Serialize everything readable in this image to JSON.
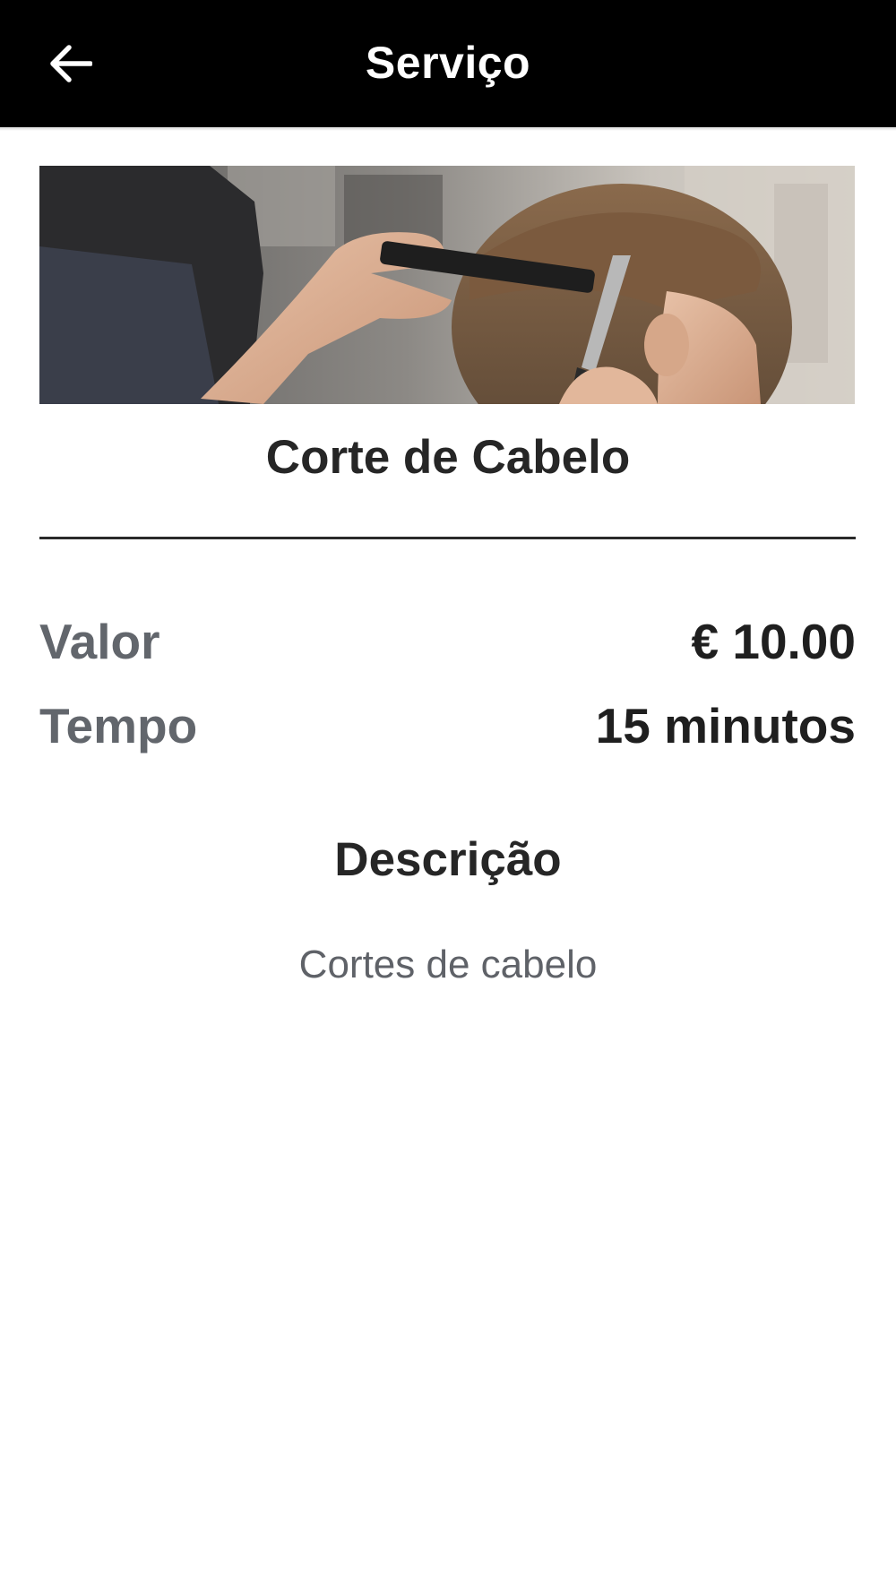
{
  "app_bar": {
    "title": "Serviço",
    "back_icon": "arrow-left-icon"
  },
  "service": {
    "image_alt": "barber-cutting-hair-photo",
    "name": "Corte de Cabelo",
    "details": [
      {
        "label": "Valor",
        "value": "€ 10.00"
      },
      {
        "label": "Tempo",
        "value": "15 minutos"
      }
    ],
    "description_title": "Descrição",
    "description_text": "Cortes de cabelo"
  },
  "colors": {
    "app_bar_bg": "#000000",
    "app_bar_text": "#ffffff",
    "label_gray": "#62666c",
    "value_dark": "#1f1f1f",
    "divider": "#2a2a2a"
  }
}
